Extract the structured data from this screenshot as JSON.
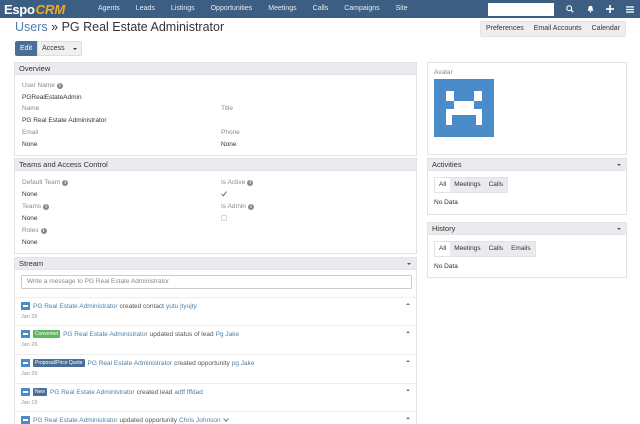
{
  "nav": {
    "logo_main": "Espo",
    "logo_accent": "CRM",
    "items": [
      "Agents",
      "Leads",
      "Listings",
      "Opportunities",
      "Meetings",
      "Calls",
      "Campaigns",
      "Site"
    ],
    "search_value": ""
  },
  "header": {
    "breadcrumb": "Users",
    "separator": " » ",
    "title": "PG Real Estate Administrator",
    "buttons": [
      "Preferences",
      "Email Accounts",
      "Calendar"
    ]
  },
  "actions": {
    "edit": "Edit",
    "access": "Access"
  },
  "overview": {
    "title": "Overview",
    "user_name_label": "User Name",
    "user_name": "PGRealEstateAdmin",
    "name_label": "Name",
    "name": "PG Real Estate Administrator",
    "title_label": "Title",
    "title_value": "",
    "email_label": "Email",
    "email": "None",
    "phone_label": "Phone",
    "phone": "None"
  },
  "teams": {
    "title": "Teams and Access Control",
    "default_team_label": "Default Team",
    "default_team": "None",
    "is_active_label": "Is Active",
    "teams_label": "Teams",
    "teams_value": "None",
    "is_admin_label": "Is Admin",
    "roles_label": "Roles",
    "roles_value": "None"
  },
  "stream": {
    "title": "Stream",
    "placeholder": "Write a message to PG Real Estate Administrator",
    "items": [
      {
        "user": "PG Real Estate Administrator",
        "tag": "",
        "action": "created contact",
        "target": "yutu jtyujty",
        "date": "Jan 26"
      },
      {
        "user": "PG Real Estate Administrator",
        "tag": "Converted",
        "action": "updated status of lead",
        "target": "Pg Jake",
        "date": "Jan 26"
      },
      {
        "user": "PG Real Estate Administrator",
        "tag": "Proposal/Price Quote",
        "action": "created opportunity",
        "target": "pg Jake",
        "date": "Jan 26"
      },
      {
        "user": "PG Real Estate Administrator",
        "tag": "New",
        "action": "created lead",
        "target": "adff fffdad",
        "date": "Jan 15"
      },
      {
        "user": "PG Real Estate Administrator",
        "tag": "",
        "action": "updated opportunity",
        "target": "Chris Johnson",
        "date": ""
      }
    ]
  },
  "avatar": {
    "label": "Avatar"
  },
  "activities": {
    "title": "Activities",
    "tabs": [
      "All",
      "Meetings",
      "Calls"
    ],
    "empty": "No Data"
  },
  "history": {
    "title": "History",
    "tabs": [
      "All",
      "Meetings",
      "Calls",
      "Emails"
    ],
    "empty": "No Data"
  },
  "colors": {
    "navbar": "#3d5e83",
    "accent": "#f7a81b",
    "link": "#4e7fa6",
    "tag_converted": "#5cb85c",
    "tag_proposal": "#4a6e95",
    "tag_new": "#4a6e95"
  },
  "icons": [
    "search-icon",
    "bell-icon",
    "plus-icon",
    "menu-icon",
    "info-icon",
    "checkbox-icon",
    "avatar-icon",
    "chevron-down-icon"
  ]
}
